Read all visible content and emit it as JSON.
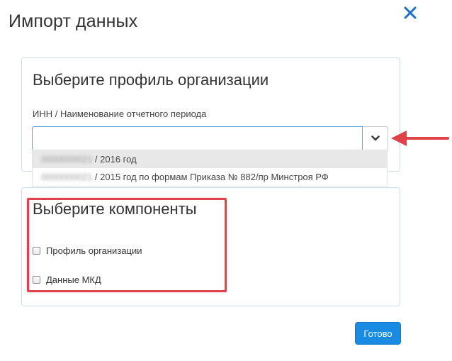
{
  "modal": {
    "title": "Импорт данных",
    "close_icon": "close-icon"
  },
  "profile_panel": {
    "heading": "Выберите профиль организации",
    "field_label": "ИНН / Наименование отчетного периода",
    "input_value": "",
    "toggle_icon": "chevron-down-icon",
    "dropdown_options": [
      {
        "masked_inn": "0000000021",
        "text": " / 2016 год",
        "highlighted": true
      },
      {
        "masked_inn": "0000000021",
        "text": " / 2015 год по формам Приказа № 882/пр Минстроя РФ",
        "highlighted": false
      }
    ]
  },
  "components_panel": {
    "heading": "Выберите компоненты",
    "checkboxes": [
      {
        "label": "Профиль организации",
        "checked": false
      },
      {
        "label": "Данные МКД",
        "checked": false
      }
    ]
  },
  "footer": {
    "submit_label": "Готово"
  },
  "colors": {
    "accent": "#1a8be3",
    "close_icon": "#1a6fc4",
    "panel_border": "#c9dff2",
    "annotation_red": "#e0424a"
  }
}
